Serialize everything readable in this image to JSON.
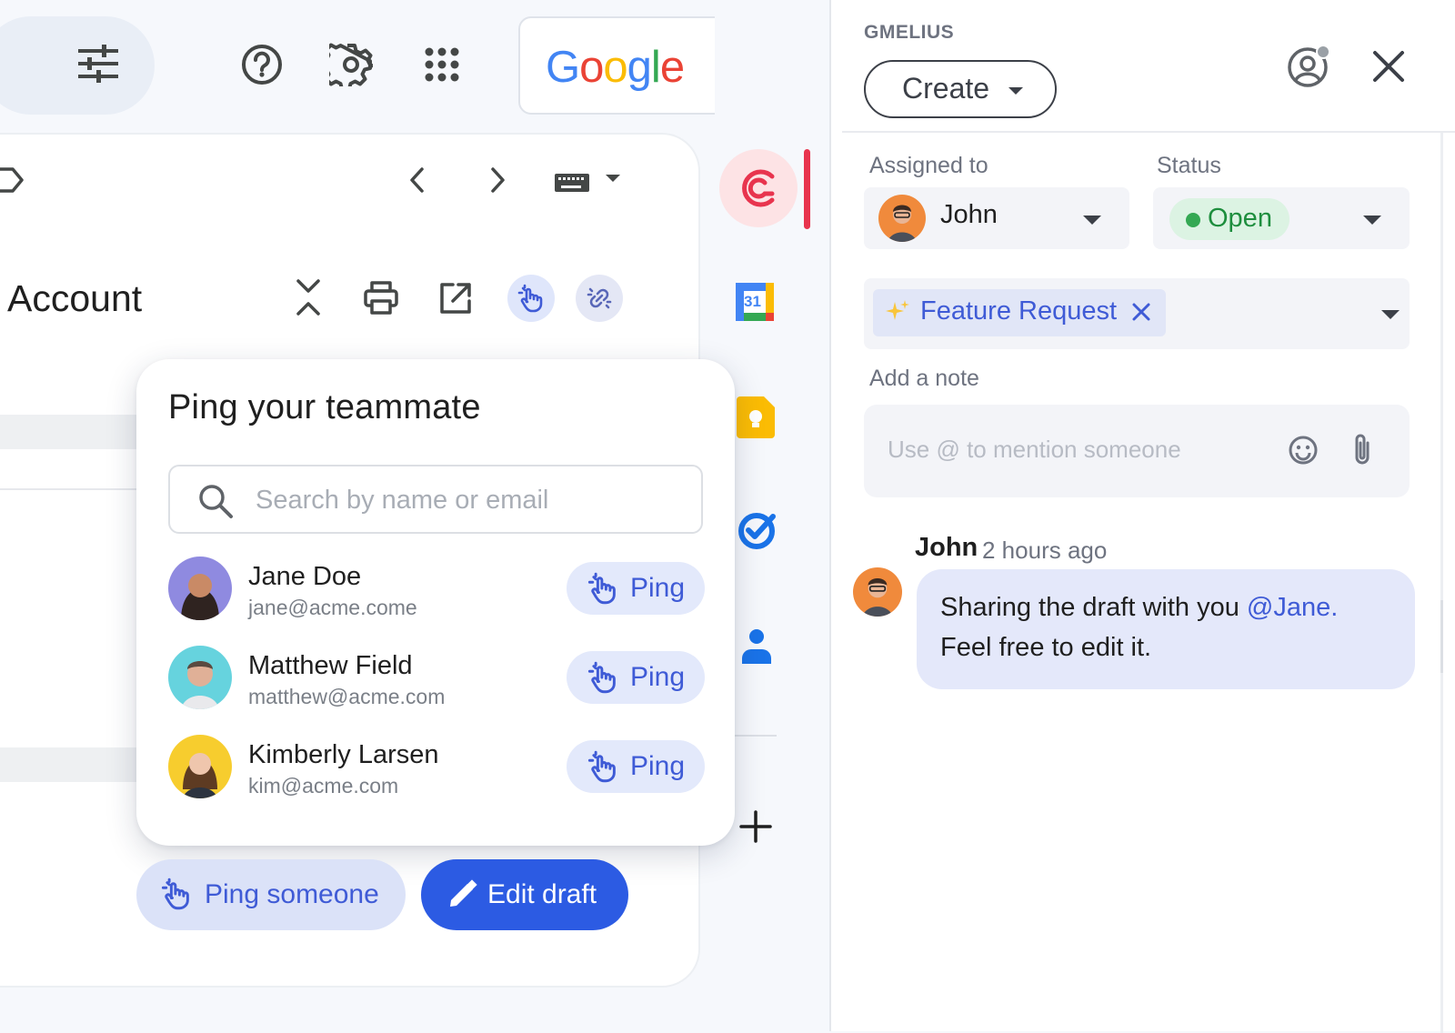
{
  "gmail": {
    "logo_text": "Google",
    "subject": "Account"
  },
  "popup": {
    "title": "Ping your teammate",
    "search_placeholder": "Search by name or email",
    "ping_label": "Ping",
    "people": [
      {
        "name": "Jane Doe",
        "email": "jane@acme.come"
      },
      {
        "name": "Matthew Field",
        "email": "matthew@acme.com"
      },
      {
        "name": "Kimberly Larsen",
        "email": "kim@acme.com"
      }
    ]
  },
  "actions": {
    "ping_someone": "Ping someone",
    "edit_draft": "Edit draft"
  },
  "sidebar_apps": {
    "calendar_day": "31"
  },
  "gmelius": {
    "brand": "GMELIUS",
    "create_label": "Create",
    "assigned_label": "Assigned to",
    "assignee": "John",
    "status_label": "Status",
    "status": "Open",
    "tag": "Feature Request",
    "note_label": "Add a note",
    "note_placeholder": "Use @ to mention someone",
    "comment": {
      "author": "John",
      "time": "2 hours ago",
      "text_before": "Sharing the draft with you ",
      "mention": "@Jane.",
      "text_after": "Feel free to edit it."
    }
  },
  "colors": {
    "accent": "#2c5be3",
    "ping_blue": "#3f5bd6",
    "status_green": "#34a853",
    "gmelius_red": "#e8344e"
  }
}
